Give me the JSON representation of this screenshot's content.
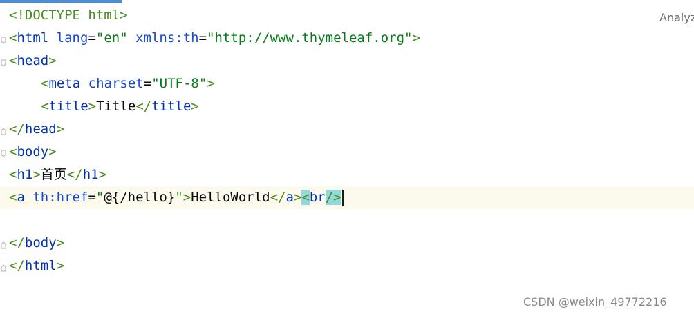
{
  "editor": {
    "analyze_label": "Analyz",
    "lines": [
      {
        "doctype": "<!DOCTYPE html>"
      },
      {
        "open": "<",
        "tag": "html",
        "a1": "lang",
        "eq1": "=",
        "v1": "\"en\"",
        "a2": "xmlns:th",
        "eq2": "=",
        "v2": "\"http://www.thymeleaf.org\"",
        "close": ">"
      },
      {
        "open": "<",
        "tag": "head",
        "close": ">"
      },
      {
        "open": "<",
        "tag": "meta",
        "a1": "charset",
        "eq1": "=",
        "v1": "\"UTF-8\"",
        "close": ">"
      },
      {
        "open": "<",
        "tag": "title",
        "close": ">",
        "text": "Title",
        "eopen": "</",
        "etag": "title",
        "eclose": ">"
      },
      {
        "open": "</",
        "tag": "head",
        "close": ">"
      },
      {
        "open": "<",
        "tag": "body",
        "close": ">"
      },
      {
        "open": "<",
        "tag": "h1",
        "close": ">",
        "text": "首页",
        "eopen": "</",
        "etag": "h1",
        "eclose": ">"
      },
      {
        "open": "<",
        "tag": "a",
        "a1": "th:href",
        "eq1": "=",
        "v1q": "\"",
        "v1": "@{/hello}",
        "v1qe": "\"",
        "close": ">",
        "text": "HelloWorld",
        "eopen": "</",
        "etag": "a",
        "eclose": ">",
        "bropen": "<",
        "brtag": "br",
        "brclose": "/>"
      },
      {},
      {
        "open": "</",
        "tag": "body",
        "close": ">"
      },
      {
        "open": "</",
        "tag": "html",
        "close": ">"
      }
    ]
  },
  "watermark": "CSDN @weixin_49772216"
}
